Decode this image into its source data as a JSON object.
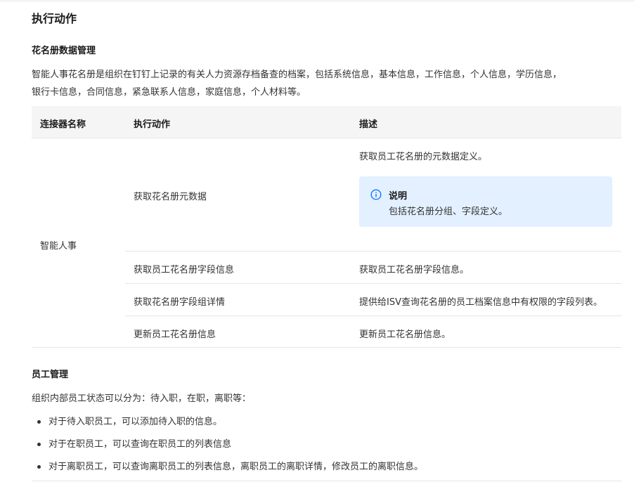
{
  "page_title": "执行动作",
  "section1": {
    "heading": "花名册数据管理",
    "intro_line1": "智能人事花名册是组织在钉钉上记录的有关人力资源存档备查的档案，包括系统信息，基本信息，工作信息，个人信息，学历信息，",
    "intro_line2": "银行卡信息，合同信息，紧急联系人信息，家庭信息，个人材料等。"
  },
  "table": {
    "headers": [
      "连接器名称",
      "执行动作",
      "描述"
    ],
    "connector": "智能人事",
    "rows": [
      {
        "action": "获取花名册元数据",
        "description": "获取员工花名册的元数据定义。",
        "note": {
          "icon": "info-icon",
          "title": "说明",
          "text": "包括花名册分组、字段定义。"
        }
      },
      {
        "action": "获取员工花名册字段信息",
        "description": "获取员工花名册字段信息。"
      },
      {
        "action": "获取花名册字段组详情",
        "description": "提供给ISV查询花名册的员工档案信息中有权限的字段列表。"
      },
      {
        "action": "更新员工花名册信息",
        "description": "更新员工花名册信息。"
      }
    ]
  },
  "section2": {
    "heading": "员工管理",
    "intro": "组织内部员工状态可以分为：待入职，在职，离职等：",
    "bullets": [
      "对于待入职员工，可以添加待入职的信息。",
      "对于在职员工，可以查询在职员工的列表信息",
      "对于离职员工，可以查询离职员工的列表信息，离职员工的离职详情，修改员工的离职信息。"
    ]
  },
  "colors": {
    "note_bg": "#e3f0ff",
    "note_icon": "#1677ff",
    "header_bg": "#f5f5f5",
    "border": "#e6e6e6"
  }
}
